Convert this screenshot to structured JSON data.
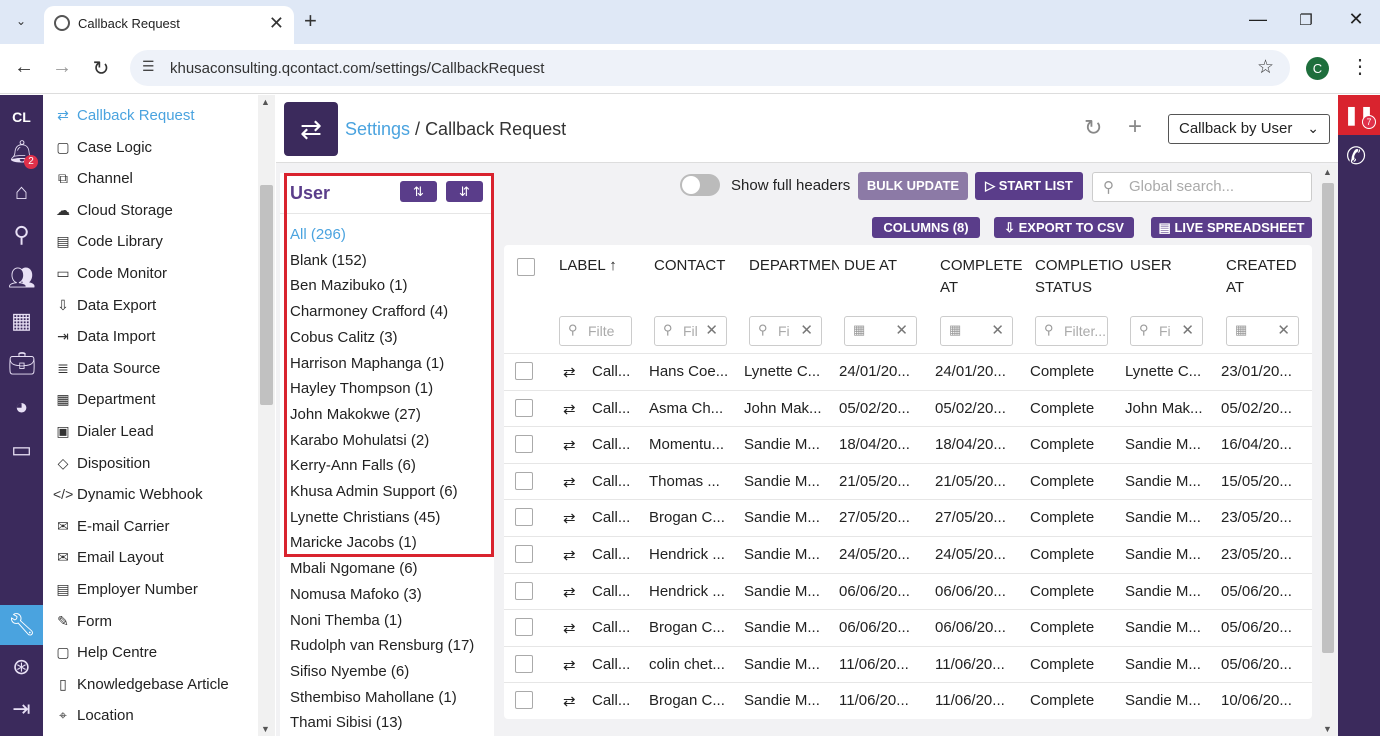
{
  "browser": {
    "tab_title": "Callback Request",
    "url": "khusaconsulting.qcontact.com/settings/CallbackRequest",
    "profile_initial": "C"
  },
  "rail": {
    "app_label": "CL",
    "notification_count": "2",
    "icons": [
      "bell-icon",
      "home-icon",
      "search-icon",
      "users-icon",
      "building-icon",
      "briefcase-icon",
      "pie-chart-icon",
      "monitor-icon",
      "wrench-icon",
      "lifebuoy-icon",
      "logout-icon"
    ]
  },
  "menu": {
    "items": [
      {
        "label": "Callback Request",
        "icon": "⇄",
        "selected": true
      },
      {
        "label": "Case Logic",
        "icon": "▢"
      },
      {
        "label": "Channel",
        "icon": "⧉"
      },
      {
        "label": "Cloud Storage",
        "icon": "☁"
      },
      {
        "label": "Code Library",
        "icon": "▤"
      },
      {
        "label": "Code Monitor",
        "icon": "▭"
      },
      {
        "label": "Data Export",
        "icon": "⇩"
      },
      {
        "label": "Data Import",
        "icon": "⇥"
      },
      {
        "label": "Data Source",
        "icon": "≣"
      },
      {
        "label": "Department",
        "icon": "▦"
      },
      {
        "label": "Dialer Lead",
        "icon": "▣"
      },
      {
        "label": "Disposition",
        "icon": "◇"
      },
      {
        "label": "Dynamic Webhook",
        "icon": "</>"
      },
      {
        "label": "E-mail Carrier",
        "icon": "✉"
      },
      {
        "label": "Email Layout",
        "icon": "✉"
      },
      {
        "label": "Employer Number",
        "icon": "▤"
      },
      {
        "label": "Form",
        "icon": "✎"
      },
      {
        "label": "Help Centre",
        "icon": "▢"
      },
      {
        "label": "Knowledgebase Article",
        "icon": "▯"
      },
      {
        "label": "Location",
        "icon": "⌖"
      }
    ]
  },
  "header": {
    "crumb_link": "Settings",
    "crumb_sep": " / ",
    "crumb_current": "Callback Request",
    "view_select": "Callback by User"
  },
  "user_panel": {
    "title": "User",
    "items": [
      "All (296)",
      "Blank (152)",
      "Ben Mazibuko (1)",
      "Charmoney Crafford (4)",
      "Cobus Calitz (3)",
      "Harrison Maphanga (1)",
      "Hayley Thompson (1)",
      "John Makokwe (27)",
      "Karabo Mohulatsi (2)",
      "Kerry-Ann Falls (6)",
      "Khusa Admin Support (6)",
      "Lynette Christians (45)",
      "Maricke Jacobs (1)",
      "Mbali Ngomane (6)",
      "Nomusa Mafoko (3)",
      "Noni Themba (1)",
      "Rudolph van Rensburg (17)",
      "Sifiso Nyembe (6)",
      "Sthembiso Mahollane (1)",
      "Thami Sibisi (13)"
    ]
  },
  "toolbar": {
    "toggle_label": "Show full headers",
    "bulk_update": "BULK UPDATE",
    "start_list": "▷ START LIST",
    "search_placeholder": "Global search...",
    "columns": "COLUMNS (8)",
    "export_csv": "EXPORT TO CSV",
    "live_spreadsheet": "LIVE SPREADSHEET"
  },
  "table": {
    "headers": [
      "LABEL ↑",
      "CONTACT",
      "DEPARTMEN",
      "DUE AT",
      "COMPLETE AT",
      "COMPLETIO STATUS",
      "USER",
      "CREATED AT"
    ],
    "filters": [
      "Filte",
      "Fil",
      "Fi",
      "",
      "",
      "Filter...",
      "Fi",
      ""
    ],
    "rows": [
      [
        "Call...",
        "Hans Coe...",
        "Lynette C...",
        "24/01/20...",
        "24/01/20...",
        "Complete",
        "Lynette C...",
        "23/01/20..."
      ],
      [
        "Call...",
        "Asma Ch...",
        "John Mak...",
        "05/02/20...",
        "05/02/20...",
        "Complete",
        "John Mak...",
        "05/02/20..."
      ],
      [
        "Call...",
        "Momentu...",
        "Sandie M...",
        "18/04/20...",
        "18/04/20...",
        "Complete",
        "Sandie M...",
        "16/04/20..."
      ],
      [
        "Call...",
        "Thomas ...",
        "Sandie M...",
        "21/05/20...",
        "21/05/20...",
        "Complete",
        "Sandie M...",
        "15/05/20..."
      ],
      [
        "Call...",
        "Brogan C...",
        "Sandie M...",
        "27/05/20...",
        "27/05/20...",
        "Complete",
        "Sandie M...",
        "23/05/20..."
      ],
      [
        "Call...",
        "Hendrick ...",
        "Sandie M...",
        "24/05/20...",
        "24/05/20...",
        "Complete",
        "Sandie M...",
        "23/05/20..."
      ],
      [
        "Call...",
        "Hendrick ...",
        "Sandie M...",
        "06/06/20...",
        "06/06/20...",
        "Complete",
        "Sandie M...",
        "05/06/20..."
      ],
      [
        "Call...",
        "Brogan C...",
        "Sandie M...",
        "06/06/20...",
        "06/06/20...",
        "Complete",
        "Sandie M...",
        "05/06/20..."
      ],
      [
        "Call...",
        "colin chet...",
        "Sandie M...",
        "11/06/20...",
        "11/06/20...",
        "Complete",
        "Sandie M...",
        "05/06/20..."
      ],
      [
        "Call...",
        "Brogan C...",
        "Sandie M...",
        "11/06/20...",
        "11/06/20...",
        "Complete",
        "Sandie M...",
        "10/06/20..."
      ]
    ]
  },
  "right_rail": {
    "badge": "7"
  }
}
